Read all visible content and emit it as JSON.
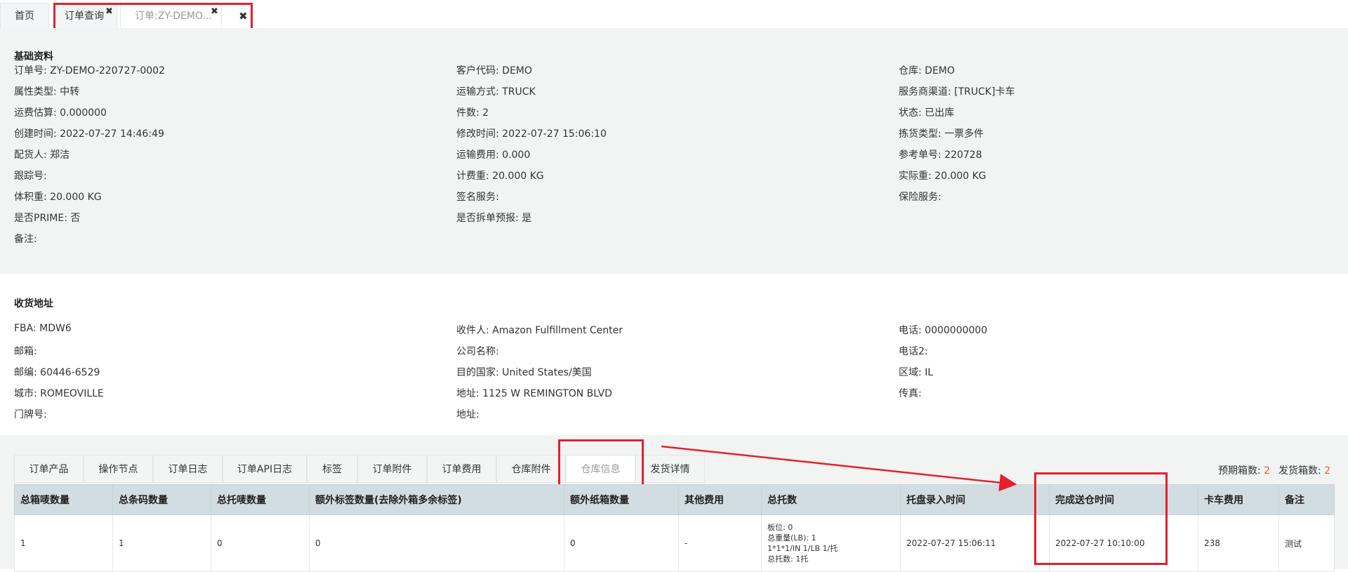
{
  "top_tabs": {
    "home": "首页",
    "order_query": "订单查询",
    "order_detail": "订单:ZY-DEMO...",
    "close_glyph": "✖"
  },
  "basic": {
    "title": "基础资料",
    "col1": [
      "订单号: ZY-DEMO-220727-0002",
      "属性类型: 中转",
      "运费估算: 0.000000",
      "创建时间: 2022-07-27 14:46:49",
      "配货人: 郑洁",
      "跟踪号:",
      "体积重: 20.000 KG",
      "是否PRIME: 否",
      "备注:"
    ],
    "col2": [
      "客户代码: DEMO",
      "运输方式: TRUCK",
      "件数: 2",
      "修改时间: 2022-07-27 15:06:10",
      "运输费用: 0.000",
      "计费重: 20.000 KG",
      "签名服务:",
      "是否拆单预报: 是"
    ],
    "col3": [
      "仓库: DEMO",
      "服务商渠道: [TRUCK]卡车",
      "状态: 已出库",
      "拣货类型: 一票多件",
      "参考单号: 220728",
      "实际重: 20.000 KG",
      "保险服务:"
    ]
  },
  "address": {
    "title": "收货地址",
    "col1": [
      "FBA: MDW6",
      "邮箱:",
      "邮编: 60446-6529",
      "城市: ROMEOVILLE",
      "门牌号:"
    ],
    "col2": [
      "收件人: Amazon Fulfillment Center",
      "公司名称:",
      "目的国家: United States/美国",
      "地址: 1125 W REMINGTON BLVD",
      "地址:"
    ],
    "col3": [
      "电话: 0000000000",
      "电话2:",
      "区域: IL",
      "传真:"
    ]
  },
  "bottom_tabs": [
    "订单产品",
    "操作节点",
    "订单日志",
    "订单API日志",
    "标签",
    "订单附件",
    "订单费用",
    "仓库附件",
    "仓库信息",
    "发货详情"
  ],
  "counts": {
    "expected_label": "预期箱数:",
    "expected_value": "2",
    "shipped_label": "发货箱数:",
    "shipped_value": "2"
  },
  "table": {
    "headers": [
      "总箱唛数量",
      "总条码数量",
      "总托唛数量",
      "额外标签数量(去除外箱多余标签)",
      "额外纸箱数量",
      "其他费用",
      "总托数",
      "托盘录入时间",
      "完成送仓时间",
      "卡车费用",
      "备注"
    ],
    "row": [
      "1",
      "1",
      "0",
      "0",
      "0",
      "-",
      "",
      "2022-07-27 15:06:11",
      "2022-07-27 10:10:00",
      "238",
      "测试"
    ],
    "pallet_lines": [
      "板位: 0",
      "总重量(LB): 1",
      "1*1*1/IN 1/LB 1/托",
      "总托数: 1托"
    ]
  },
  "colors": {
    "annotation_red": "#e5202e",
    "count_orange": "#f0572b",
    "table_header_bg": "#d2dde2",
    "section_bg": "#f2f4f3"
  }
}
